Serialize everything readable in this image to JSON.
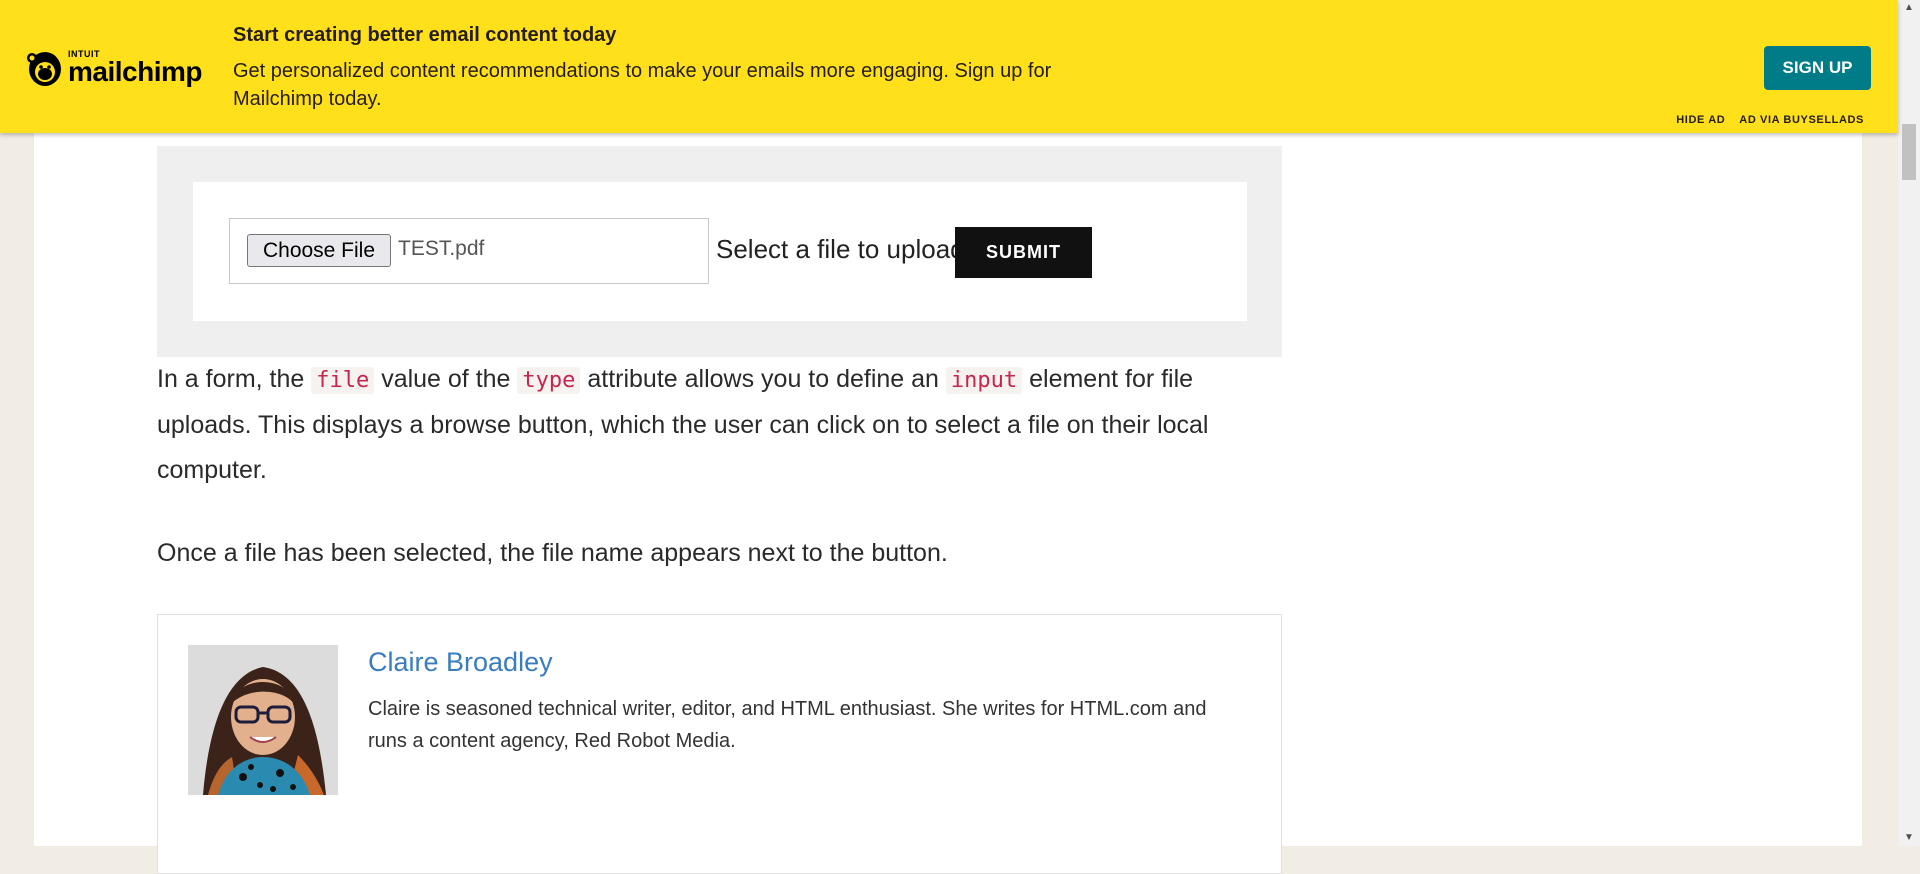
{
  "ad": {
    "logo_small": "INTUIT",
    "logo_big": "mailchimp",
    "headline": "Start creating better email content today",
    "body": "Get personalized content recommendations to make your emails more engaging. Sign up for Mailchimp today.",
    "cta": "SIGN UP",
    "hide_ad": "HIDE AD",
    "ad_via": "AD VIA BUYSELLADS",
    "brand_color": "#ffe01b",
    "cta_color": "#007c89"
  },
  "demo": {
    "choose_file_label": "Choose File",
    "file_name": "TEST.pdf",
    "select_label": "Select a file to upload",
    "submit_label": "SUBMIT"
  },
  "article": {
    "p1_a": "In a form, the",
    "p1_code1": "file",
    "p1_b": "value of the",
    "p1_code2": "type",
    "p1_c": "attribute allows you to define an",
    "p1_code3": "input",
    "p1_d": "element for file uploads. This displays a browse button, which the user can click on to select a file on their local computer.",
    "p2": "Once a file has been selected, the file name appears next to the button."
  },
  "author": {
    "name": "Claire Broadley",
    "bio": "Claire is seasoned technical writer, editor, and HTML enthusiast. She writes for HTML.com and runs a content agency, Red Robot Media."
  },
  "icons": {
    "logo": "mailchimp-freddie-icon",
    "scroll_up": "scroll-up-arrow-icon",
    "scroll_down": "scroll-down-arrow-icon"
  }
}
